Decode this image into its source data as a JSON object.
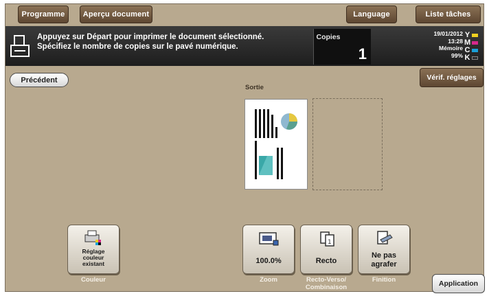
{
  "tabs": {
    "programme": "Programme",
    "apercu": "Aperçu document",
    "language": "Language",
    "liste_taches": "Liste tâches"
  },
  "message": {
    "line1": "Appuyez sur Départ pour imprimer le document sélectionné.",
    "line2": "Spécifiez le nombre de copies sur le pavé numérique."
  },
  "copies": {
    "label": "Copies",
    "value": "1"
  },
  "status": {
    "date": "19/01/2012",
    "time": "13:28",
    "memory_label": "Mémoire",
    "memory_value": "99%"
  },
  "toner": [
    {
      "letter": "Y",
      "color": "#f0d020"
    },
    {
      "letter": "M",
      "color": "#d6288c"
    },
    {
      "letter": "C",
      "color": "#1aa0d8"
    },
    {
      "letter": "K",
      "color": "#2a2a2a"
    }
  ],
  "buttons": {
    "precedent": "Précédent",
    "verif_reglages": "Vérif. réglages",
    "application": "Application"
  },
  "preview": {
    "sortie_label": "Sortie"
  },
  "functions": {
    "couleur": {
      "text1": "Réglage",
      "text2": "couleur",
      "text3": "existant",
      "caption": "Couleur"
    },
    "zoom": {
      "text": "100.0%",
      "caption": "Zoom"
    },
    "recto": {
      "text": "Recto",
      "caption1": "Recto-Verso/",
      "caption2": "Combinaison"
    },
    "finition": {
      "text1": "Ne pas",
      "text2": "agrafer",
      "caption": "Finition"
    }
  }
}
